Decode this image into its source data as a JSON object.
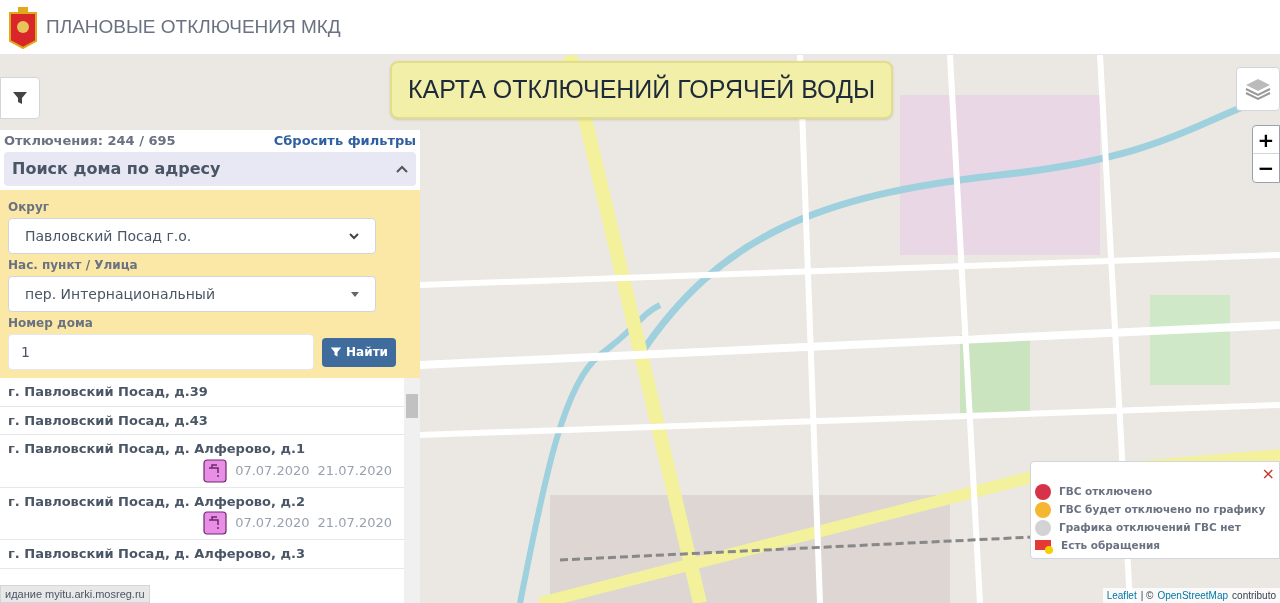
{
  "header": {
    "title": "ПЛАНОВЫЕ ОТКЛЮЧЕНИЯ МКД"
  },
  "map": {
    "banner": "КАРТА ОТКЛЮЧЕНИЙ ГОРЯЧЕЙ ВОДЫ",
    "zoom_in": "+",
    "zoom_out": "−",
    "attribution_link": "Leaflet",
    "attribution_sep": "| ©",
    "attribution_osm": "OpenStreetMap",
    "attribution_rest": "contributo"
  },
  "panel": {
    "count": "Отключения: 244 / 695",
    "reset": "Сбросить фильтры",
    "section": {
      "title": "Поиск дома по адресу",
      "expanded": true
    },
    "fields": [
      {
        "label": "Округ",
        "value": "Павловский Посад г.о.",
        "kind": "select"
      },
      {
        "label": "Нас. пункт / Улица",
        "value": "пер. Интернациональный",
        "kind": "combo"
      },
      {
        "label": "Номер дома",
        "value": "1",
        "kind": "input"
      }
    ],
    "search_button": "Найти",
    "results": [
      {
        "address": "г. Павловский Посад, д.39"
      },
      {
        "address": "г. Павловский Посад, д.43"
      },
      {
        "address": "г. Павловский Посад, д. Алферово, д.1",
        "start": "07.07.2020",
        "end": "21.07.2020"
      },
      {
        "address": "г. Павловский Посад, д. Алферово, д.2",
        "start": "07.07.2020",
        "end": "21.07.2020"
      },
      {
        "address": "г. Павловский Посад, д. Алферово, д.3"
      }
    ]
  },
  "legend": {
    "close": "×",
    "items": [
      {
        "kind": "dot",
        "color": "#d6334a",
        "label": "ГВС отключено"
      },
      {
        "kind": "dot",
        "color": "#f5b731",
        "label": "ГВС будет отключено по графику"
      },
      {
        "kind": "dot",
        "color": "#d3d3d3",
        "label": "Графика отключений ГВС нет"
      },
      {
        "kind": "mail",
        "label": "Есть обращения"
      }
    ]
  },
  "status_bar": "идание myitu.arki.mosreg.ru"
}
